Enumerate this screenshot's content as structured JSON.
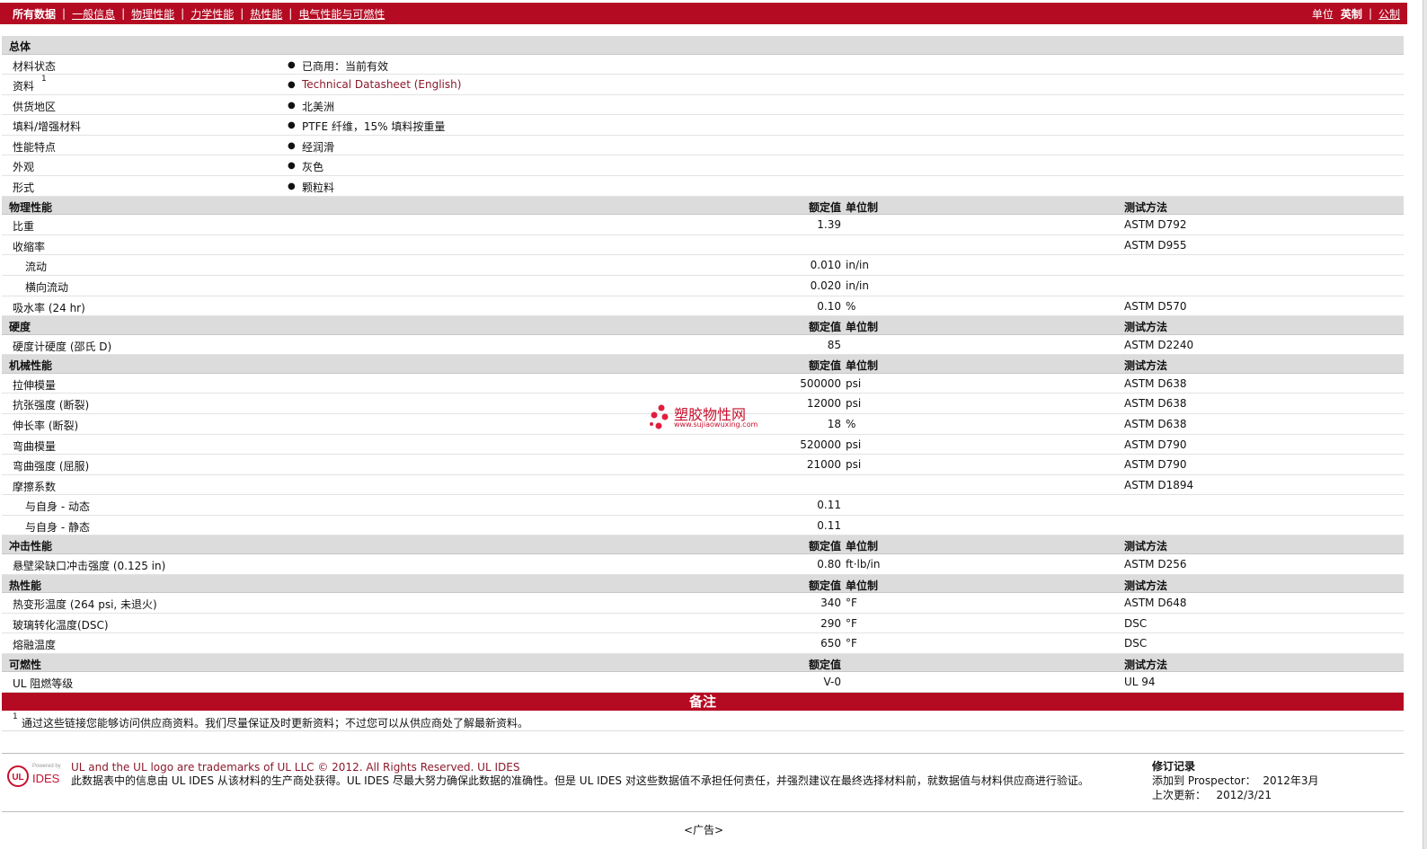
{
  "nav": {
    "items": [
      "所有数据",
      "一般信息",
      "物理性能",
      "力学性能",
      "热性能",
      "电气性能与可燃性"
    ],
    "separator": "|",
    "unit_label": "单位",
    "unit_options": [
      "英制",
      "公制"
    ]
  },
  "general": {
    "title": "总体",
    "rows": [
      {
        "label": "材料状态",
        "value": "已商用：当前有效"
      },
      {
        "label": "资料",
        "sup": "1",
        "value": "Technical Datasheet (English)"
      },
      {
        "label": "供货地区",
        "value": "北美洲"
      },
      {
        "label": "填料/增强材料",
        "value": "PTFE 纤维，15% 填料按重量"
      },
      {
        "label": "性能特点",
        "value": "经润滑"
      },
      {
        "label": "外观",
        "value": "灰色"
      },
      {
        "label": "形式",
        "value": "颗粒料"
      }
    ]
  },
  "col_headers": {
    "nominal": "额定值",
    "unit": "单位制",
    "test": "测试方法"
  },
  "sections": [
    {
      "title": "物理性能",
      "rows": [
        {
          "label": "比重",
          "nominal": "1.39",
          "unit": "",
          "test": "ASTM D792"
        },
        {
          "label": "收缩率",
          "nominal": "",
          "unit": "",
          "test": "ASTM D955"
        },
        {
          "label": "流动",
          "sub": true,
          "nominal": "0.010",
          "unit": "in/in",
          "test": ""
        },
        {
          "label": "横向流动",
          "sub": true,
          "nominal": "0.020",
          "unit": "in/in",
          "test": ""
        },
        {
          "label": "吸水率 (24 hr)",
          "nominal": "0.10",
          "unit": "%",
          "test": "ASTM D570"
        }
      ]
    },
    {
      "title": "硬度",
      "rows": [
        {
          "label": "硬度计硬度 (邵氏 D)",
          "nominal": "85",
          "unit": "",
          "test": "ASTM D2240"
        }
      ]
    },
    {
      "title": "机械性能",
      "rows": [
        {
          "label": "拉伸模量",
          "nominal": "500000",
          "unit": "psi",
          "test": "ASTM D638"
        },
        {
          "label": "抗张强度 (断裂)",
          "nominal": "12000",
          "unit": "psi",
          "test": "ASTM D638"
        },
        {
          "label": "伸长率 (断裂)",
          "nominal": "18",
          "unit": "%",
          "test": "ASTM D638"
        },
        {
          "label": "弯曲模量",
          "nominal": "520000",
          "unit": "psi",
          "test": "ASTM D790"
        },
        {
          "label": "弯曲强度 (屈服)",
          "nominal": "21000",
          "unit": "psi",
          "test": "ASTM D790"
        },
        {
          "label": "摩擦系数",
          "nominal": "",
          "unit": "",
          "test": "ASTM D1894"
        },
        {
          "label": "与自身 - 动态",
          "sub": true,
          "nominal": "0.11",
          "unit": "",
          "test": ""
        },
        {
          "label": "与自身 - 静态",
          "sub": true,
          "nominal": "0.11",
          "unit": "",
          "test": ""
        }
      ]
    },
    {
      "title": "冲击性能",
      "rows": [
        {
          "label": "悬壁梁缺口冲击强度 (0.125 in)",
          "nominal": "0.80",
          "unit": "ft·lb/in",
          "test": "ASTM D256"
        }
      ]
    },
    {
      "title": "热性能",
      "rows": [
        {
          "label": "热变形温度 (264 psi, 未退火)",
          "nominal": "340",
          "unit": "°F",
          "test": "ASTM D648"
        },
        {
          "label": "玻璃转化温度(DSC)",
          "nominal": "290",
          "unit": "°F",
          "test": "DSC"
        },
        {
          "label": "熔融温度",
          "nominal": "650",
          "unit": "°F",
          "test": "DSC"
        }
      ]
    },
    {
      "title": "可燃性",
      "no_unit": true,
      "rows": [
        {
          "label": "UL 阻燃等级",
          "nominal": "V-0",
          "unit": "",
          "test": "UL 94"
        }
      ]
    }
  ],
  "notes": {
    "title": "备注",
    "footnote_num": "1",
    "footnote": "通过这些链接您能够访问供应商资料。我们尽量保证及时更新资料；不过您可以从供应商处了解最新资料。"
  },
  "footer": {
    "logo_small": "Powered by",
    "logo_text": "IDES",
    "trademark": "UL and the UL logo are trademarks of UL LLC © 2012. All Rights Reserved. UL IDES",
    "disclaimer": "此数据表中的信息由 UL IDES 从该材料的生产商处获得。UL IDES 尽最大努力确保此数据的准确性。但是 UL IDES 对这些数据值不承担任何责任，并强烈建议在最终选择材料前，就数据值与材料供应商进行验证。",
    "revision_title": "修订记录",
    "added_label": "添加到 Prospector：",
    "added_value": "2012年3月",
    "updated_label": "上次更新：",
    "updated_value": "2012/3/21"
  },
  "ad": "<广告>",
  "watermark": {
    "text": "塑胶物性网",
    "sub": "www.sujiaowuxing.com"
  },
  "colors": {
    "brand": "#b40a22",
    "header_bg": "#dcdcdc",
    "link": "#8b1a2b"
  }
}
